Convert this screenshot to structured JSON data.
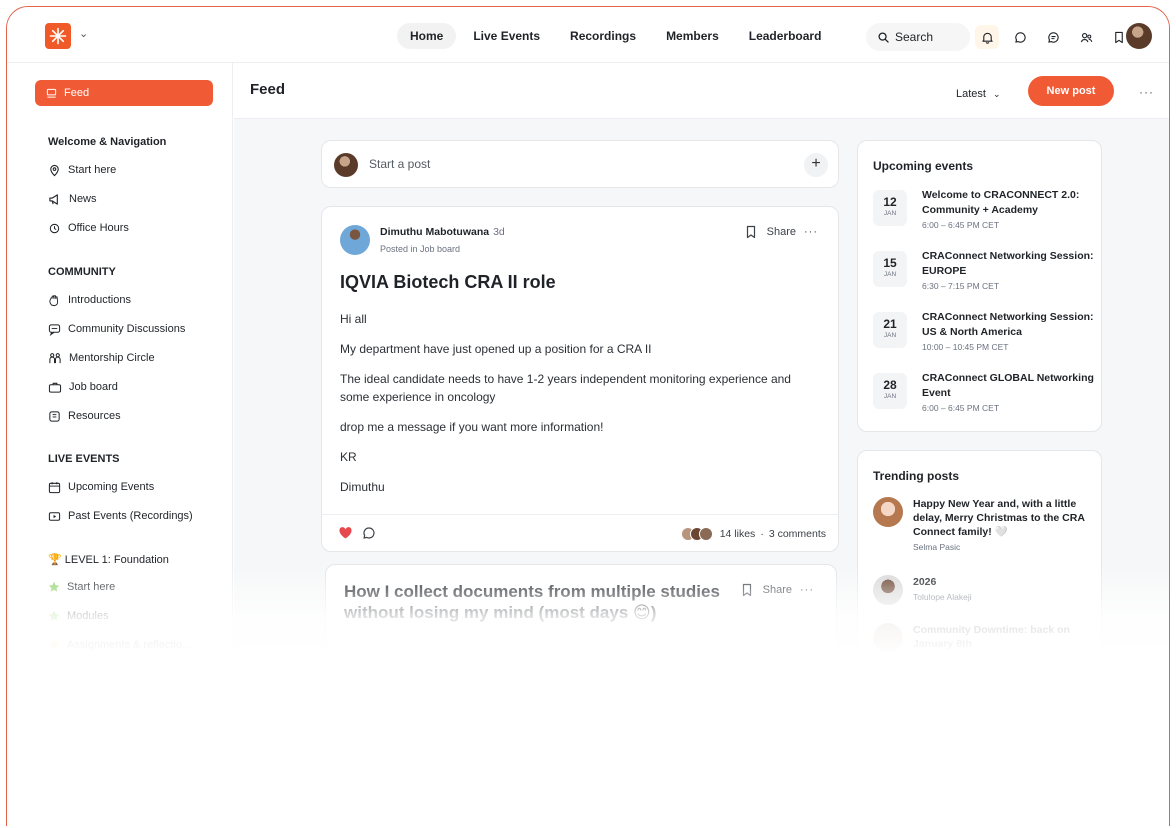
{
  "nav": [
    "Home",
    "Live Events",
    "Recordings",
    "Members",
    "Leaderboard"
  ],
  "search_label": "Search",
  "sidebar": {
    "feed": "Feed",
    "sec_welcome": "Welcome & Navigation",
    "start_here": "Start here",
    "news": "News",
    "office_hours": "Office Hours",
    "sec_community": "COMMUNITY",
    "introductions": "Introductions",
    "community_discussions": "Community Discussions",
    "mentorship": "Mentorship Circle",
    "job_board": "Job board",
    "resources": "Resources",
    "sec_live": "LIVE EVENTS",
    "upcoming_events": "Upcoming Events",
    "past_events": "Past Events (Recordings)",
    "sec_level1": "🏆 LEVEL 1: Foundation",
    "l1_start": "Start here",
    "l1_modules": "Modules",
    "l1_assign": "Assignments & reflectio..."
  },
  "header": {
    "title": "Feed",
    "sort": "Latest",
    "new_post": "New post"
  },
  "composer": {
    "placeholder": "Start a post"
  },
  "post": {
    "author": "Dimuthu Mabotuwana",
    "time": "3d",
    "posted_in": "Posted in Job board",
    "share": "Share",
    "title": "IQVIA Biotech CRA II role",
    "paragraphs": [
      "Hi all",
      "My department have just opened up a position for a CRA II",
      "The ideal candidate needs to have 1-2 years independent monitoring experience and some experience in oncology",
      "drop me a message if you want more information!",
      "KR",
      "Dimuthu"
    ],
    "likes": "14 likes",
    "comments": "3 comments"
  },
  "post2": {
    "title": "How I collect documents from multiple studies without losing my mind (most days 😊)",
    "share": "Share"
  },
  "events": {
    "title": "Upcoming events",
    "items": [
      {
        "day": "12",
        "month": "JAN",
        "title": "Welcome to CRACONNECT 2.0: Community + Academy",
        "time": "6:00 – 6:45 PM CET"
      },
      {
        "day": "15",
        "month": "JAN",
        "title": "CRAConnect Networking Session: EUROPE",
        "time": "6:30 – 7:15 PM CET"
      },
      {
        "day": "21",
        "month": "JAN",
        "title": "CRAConnect Networking Session: US & North America",
        "time": "10:00 – 10:45 PM CET"
      },
      {
        "day": "28",
        "month": "JAN",
        "title": "CRAConnect GLOBAL Networking Event",
        "time": "6:00 – 6:45 PM CET"
      }
    ]
  },
  "trending": {
    "title": "Trending posts",
    "items": [
      {
        "title": "Happy New Year and, with a little delay, Merry Christmas to the CRA Connect family! 🤍",
        "author": "Selma Pasic"
      },
      {
        "title": "2026",
        "author": "Tolulope Alakeji"
      },
      {
        "title": "Community Downtime: back on January 8th",
        "author": ""
      }
    ]
  },
  "colors": {
    "accent": "#f05a35",
    "border": "#e2654a"
  }
}
